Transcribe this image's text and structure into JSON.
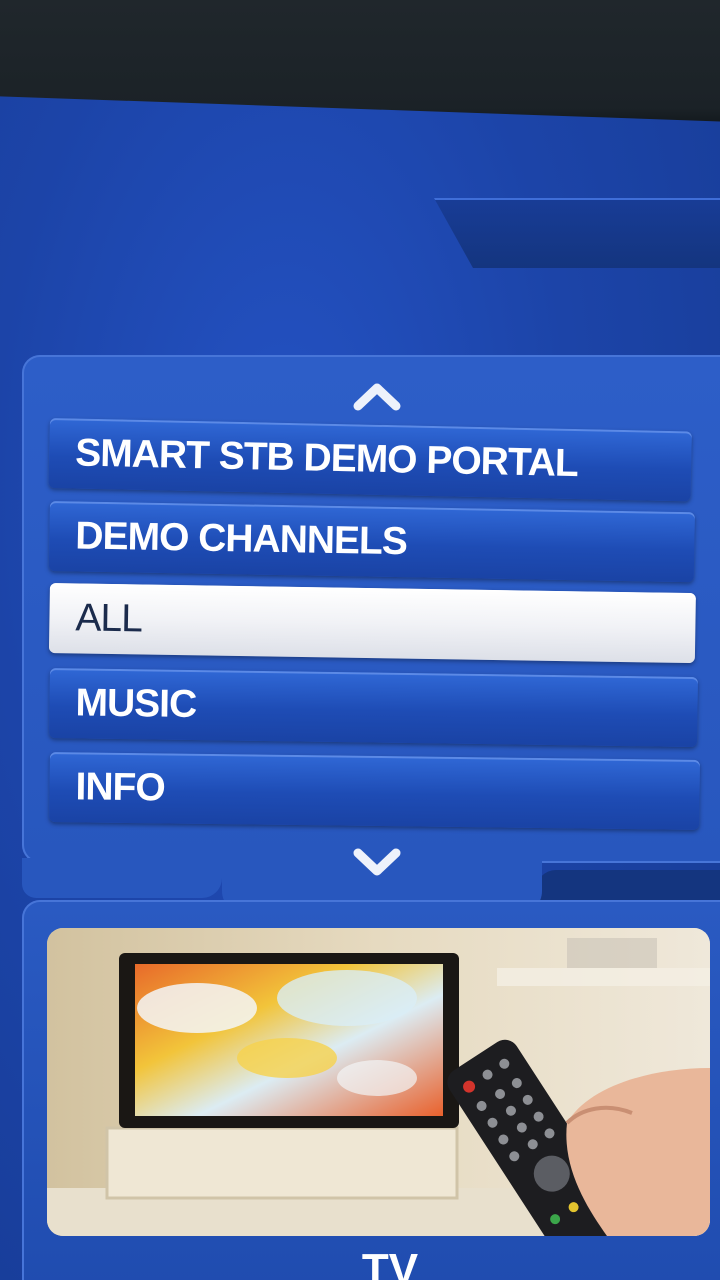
{
  "menu": {
    "items": [
      {
        "label": "SMART STB DEMO PORTAL",
        "selected": false
      },
      {
        "label": "DEMO CHANNELS",
        "selected": false
      },
      {
        "label": "ALL",
        "selected": true
      },
      {
        "label": "MUSIC",
        "selected": false
      },
      {
        "label": "INFO",
        "selected": false
      }
    ],
    "scroll_up_icon": "chevron-up-icon",
    "scroll_down_icon": "chevron-down-icon"
  },
  "preview": {
    "label": "TV",
    "image": "tv-remote-control-photo"
  },
  "colors": {
    "background_blue": "#1c44a8",
    "panel_blue": "#2857be",
    "item_blue": "#1e4cb5",
    "selected_item": "#f1f2f6",
    "selected_text": "#1b2b4c",
    "text": "#ffffff"
  }
}
